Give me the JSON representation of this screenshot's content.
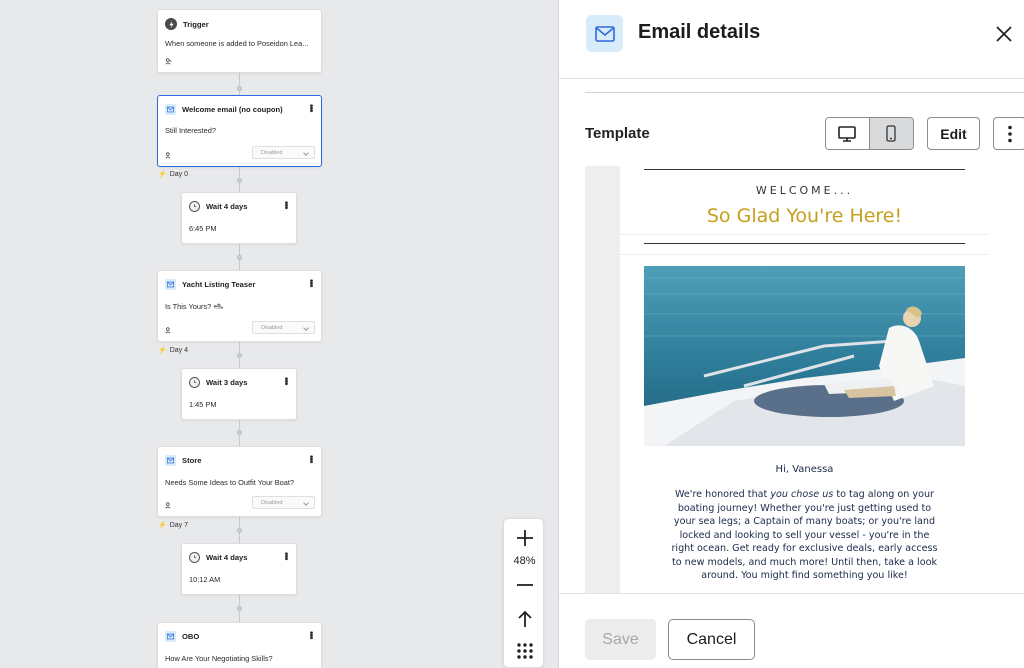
{
  "flow": {
    "trigger": {
      "title": "Trigger",
      "subtitle": "When someone is added to Poseidon Lea..."
    },
    "nodes": [
      {
        "type": "email",
        "title": "Welcome email (no coupon)",
        "subject": "Still Interested?",
        "status": "Disabled",
        "day": "Day 0"
      },
      {
        "type": "wait",
        "title": "Wait 4 days",
        "time": "6:45 PM"
      },
      {
        "type": "email",
        "title": "Yacht Listing Teaser",
        "subject": "Is This Yours? 🛥",
        "status": "Disabled",
        "day": "Day 4"
      },
      {
        "type": "wait",
        "title": "Wait 3 days",
        "time": "1:45 PM"
      },
      {
        "type": "email",
        "title": "Store",
        "subject": "Needs Some Ideas to Outfit Your Boat?",
        "status": "Disabled",
        "day": "Day 7"
      },
      {
        "type": "wait",
        "title": "Wait 4 days",
        "time": "10:12 AM"
      },
      {
        "type": "email",
        "title": "OBO",
        "subject": "How Are Your Negotiating Skills?"
      }
    ],
    "zoom": {
      "level": "48%"
    }
  },
  "panel": {
    "title": "Email details",
    "template_label": "Template",
    "edit_label": "Edit",
    "view_mode": "mobile",
    "save_label": "Save",
    "cancel_label": "Cancel"
  },
  "email_preview": {
    "welcome": "WELCOME...",
    "headline": "So Glad You're Here!",
    "greeting": "Hi, Vanessa",
    "body_pre": "We're honored that ",
    "body_em": "you chose us",
    "body_post": " to tag along on your boating journey! Whether you're just getting used to your sea legs; a Captain of many boats; or you're land locked and looking to sell your vessel - you're in the right ocean. Get ready for exclusive deals, early access to new models, and much more! Until then, take a look around. You might find something you like!"
  },
  "colors": {
    "accent_blue": "#2d6be0",
    "headline_gold": "#c5a01e",
    "icon_bg": "#d8ebf8"
  }
}
